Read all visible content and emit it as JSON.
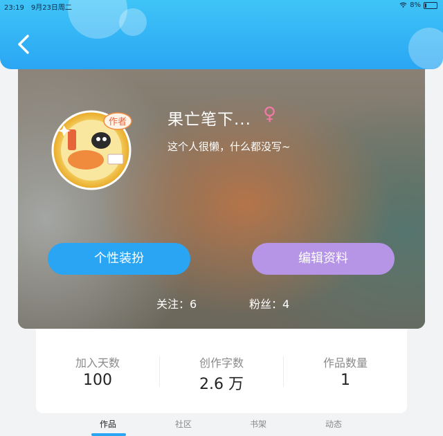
{
  "status_bar": {
    "time": "23:19",
    "date": "9月23日周二",
    "battery": "8%"
  },
  "profile": {
    "name": "果亡笔下...",
    "gender_symbol": "♀",
    "bio": "这个人很懒，什么都没写~",
    "badge_text": "作者",
    "buttons": {
      "dress_up": "个性装扮",
      "edit": "编辑资料"
    },
    "following": "关注：6",
    "followers": "粉丝：4"
  },
  "stats": [
    {
      "label": "加入天数",
      "value": "100"
    },
    {
      "label": "创作字数",
      "value": "2.6 万"
    },
    {
      "label": "作品数量",
      "value": "1"
    }
  ],
  "tabs": [
    {
      "label": "作品",
      "active": true
    },
    {
      "label": "社区",
      "active": false
    },
    {
      "label": "书架",
      "active": false
    },
    {
      "label": "动态",
      "active": false
    }
  ],
  "colors": {
    "header": "#2aa6f3",
    "dress_button": "#2aa5f4",
    "edit_button": "#b694e6",
    "gender": "#f07aa6"
  }
}
